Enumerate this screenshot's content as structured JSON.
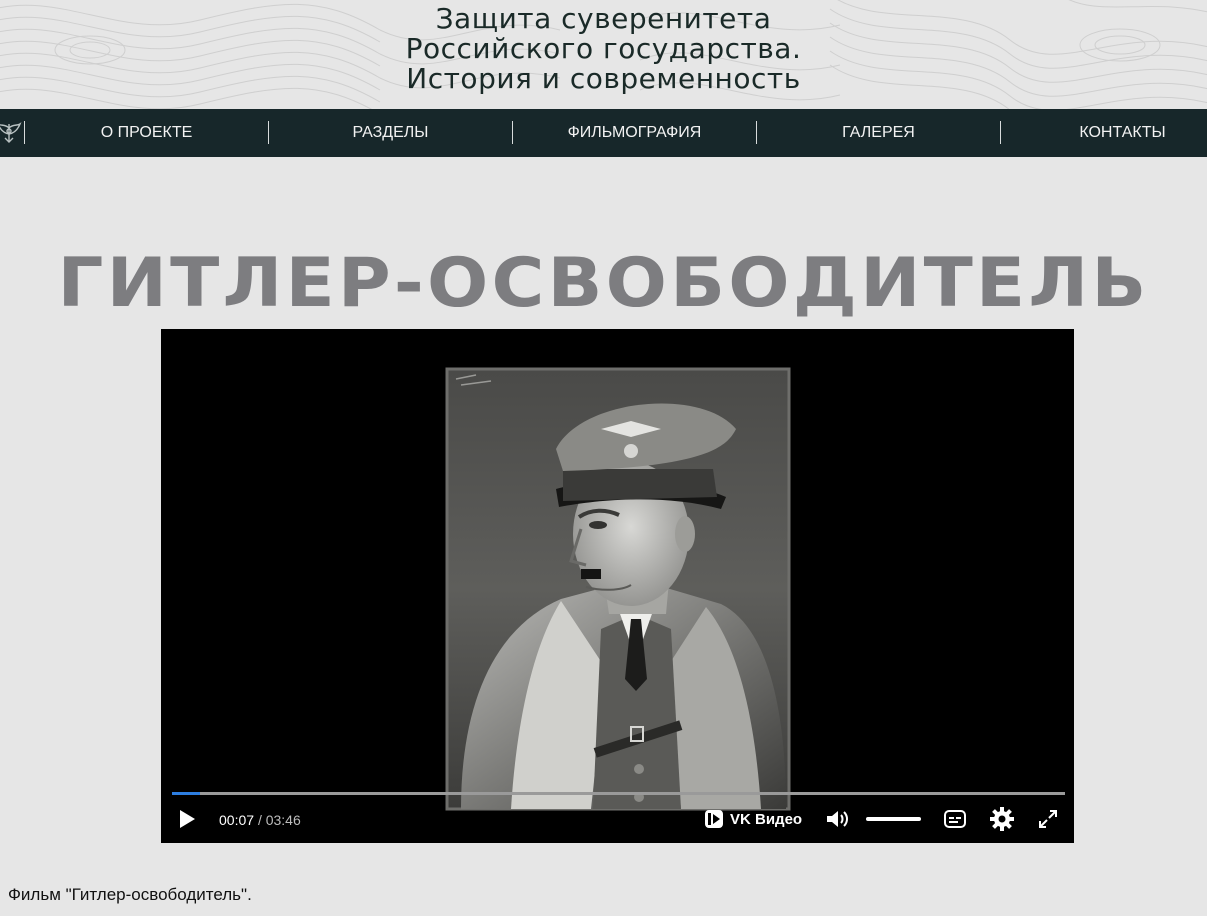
{
  "header": {
    "title_lines": [
      "Защита суверенитета",
      "Российского государства.",
      "История и современность"
    ]
  },
  "nav": {
    "items": [
      {
        "label": "О ПРОЕКТЕ"
      },
      {
        "label": "РАЗДЕЛЫ"
      },
      {
        "label": "ФИЛЬМОГРАФИЯ"
      },
      {
        "label": "ГАЛЕРЕЯ"
      },
      {
        "label": "КОНТАКТЫ"
      }
    ]
  },
  "main": {
    "film_title": "ГИТЛЕР-ОСВОБОДИТЕЛЬ",
    "caption": "Фильм \"Гитлер-освободитель\"."
  },
  "player": {
    "current_time": "00:07",
    "time_separator": "/",
    "total_time": "03:46",
    "progress_fraction": 0.031,
    "brand_label": "VK Видео",
    "icons": {
      "play": "play-icon",
      "brand": "vk-video-icon",
      "volume": "volume-icon",
      "subtitles": "subtitles-icon",
      "settings": "gear-icon",
      "fullscreen": "fullscreen-icon"
    }
  },
  "colors": {
    "page_background": "#e6e6e6",
    "nav_background": "#17272a",
    "title_gray": "#7d7d80",
    "progress_accent": "#2d7ee0"
  }
}
